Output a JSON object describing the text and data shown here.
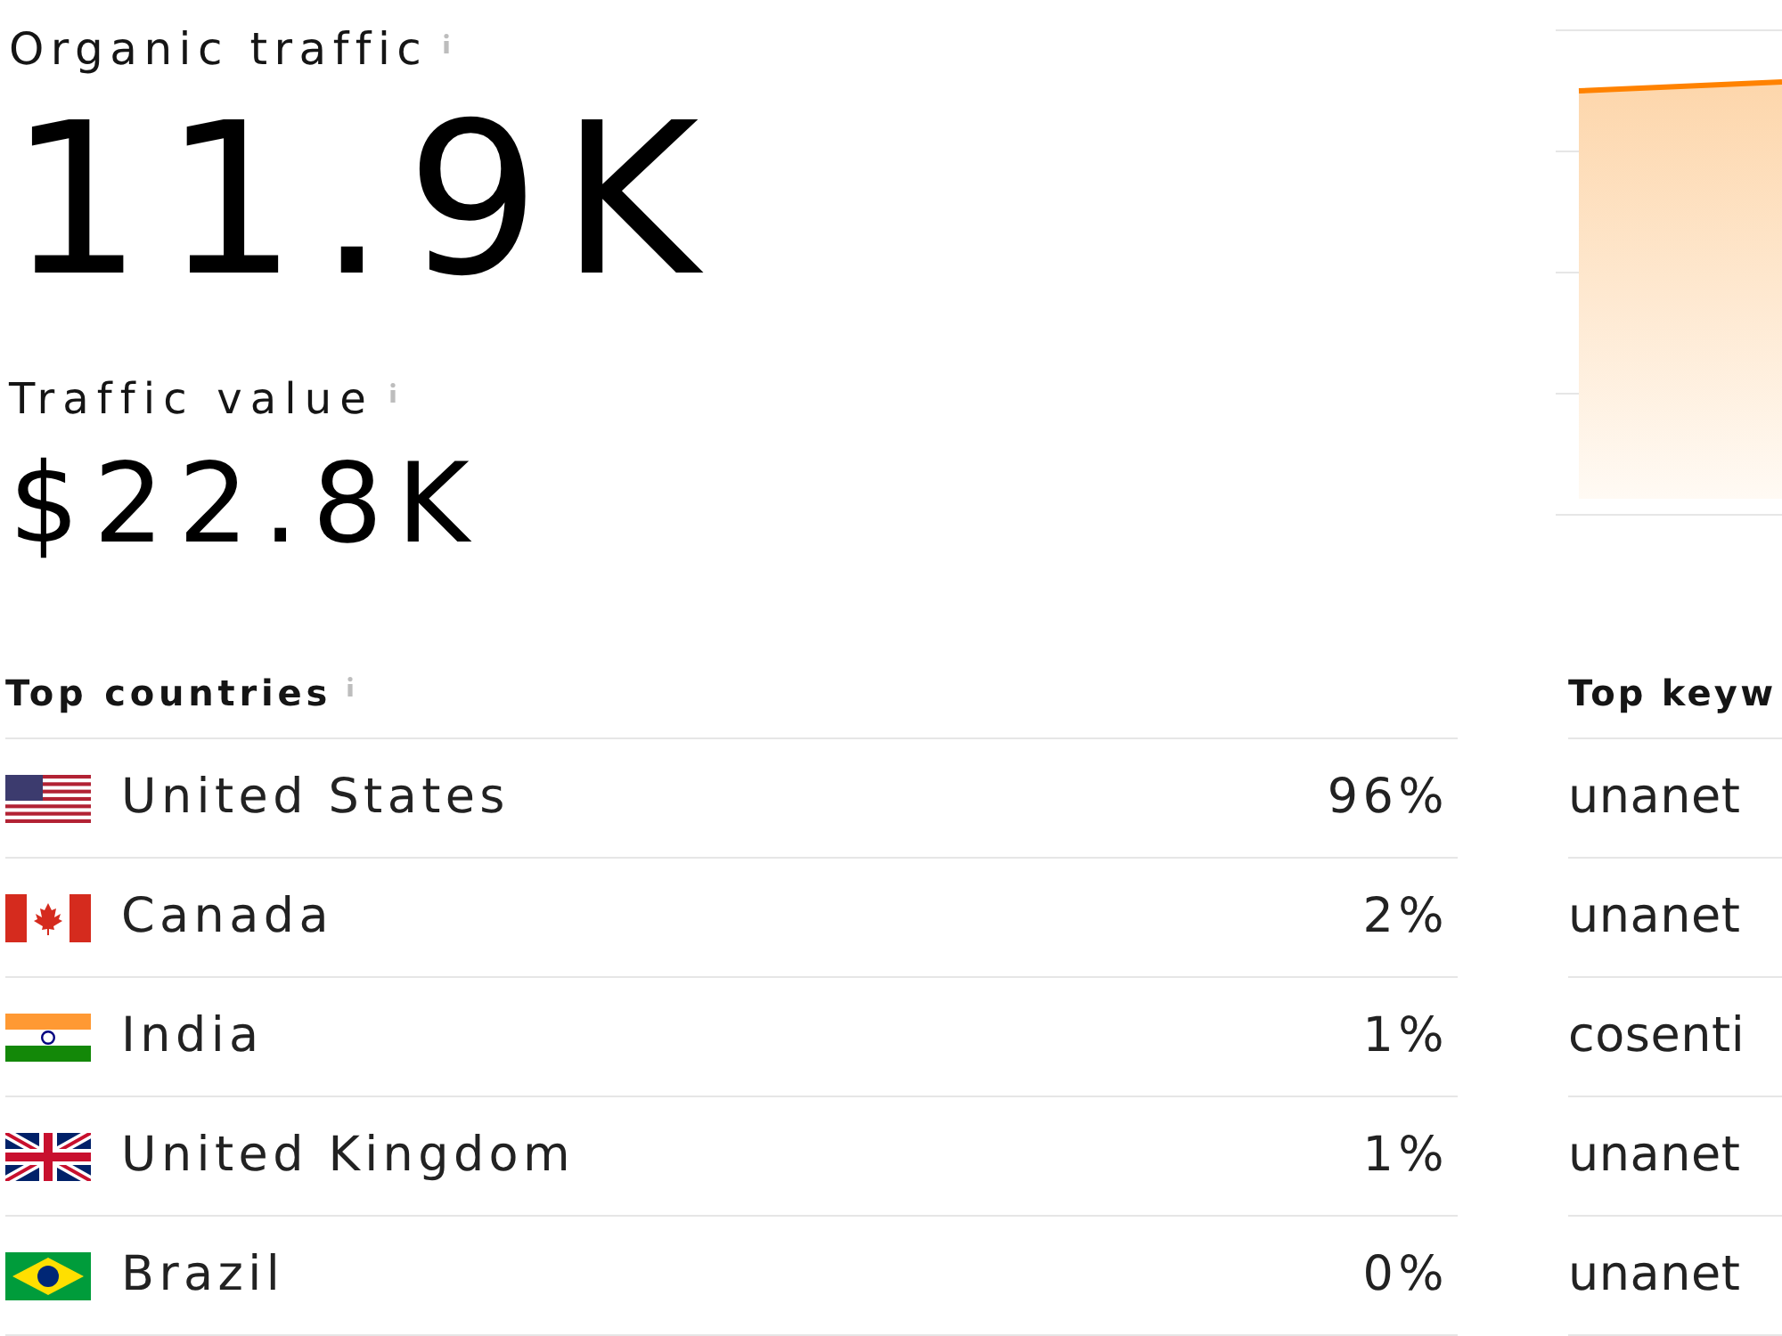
{
  "organic_traffic": {
    "label": "Organic traffic",
    "value": "11.9K"
  },
  "traffic_value": {
    "label": "Traffic value",
    "value": "$22.8K"
  },
  "top_countries": {
    "title": "Top countries",
    "rows": [
      {
        "kind": "us",
        "country": "United States",
        "share": "96%"
      },
      {
        "kind": "ca",
        "country": "Canada",
        "share": "2%"
      },
      {
        "kind": "in",
        "country": "India",
        "share": "1%"
      },
      {
        "kind": "gb",
        "country": "United Kingdom",
        "share": "1%"
      },
      {
        "kind": "br",
        "country": "Brazil",
        "share": "0%"
      }
    ]
  },
  "top_keywords": {
    "title": "Top keyw",
    "rows": [
      "unanet",
      "unanet",
      "cosenti",
      "unanet",
      "unanet"
    ]
  }
}
